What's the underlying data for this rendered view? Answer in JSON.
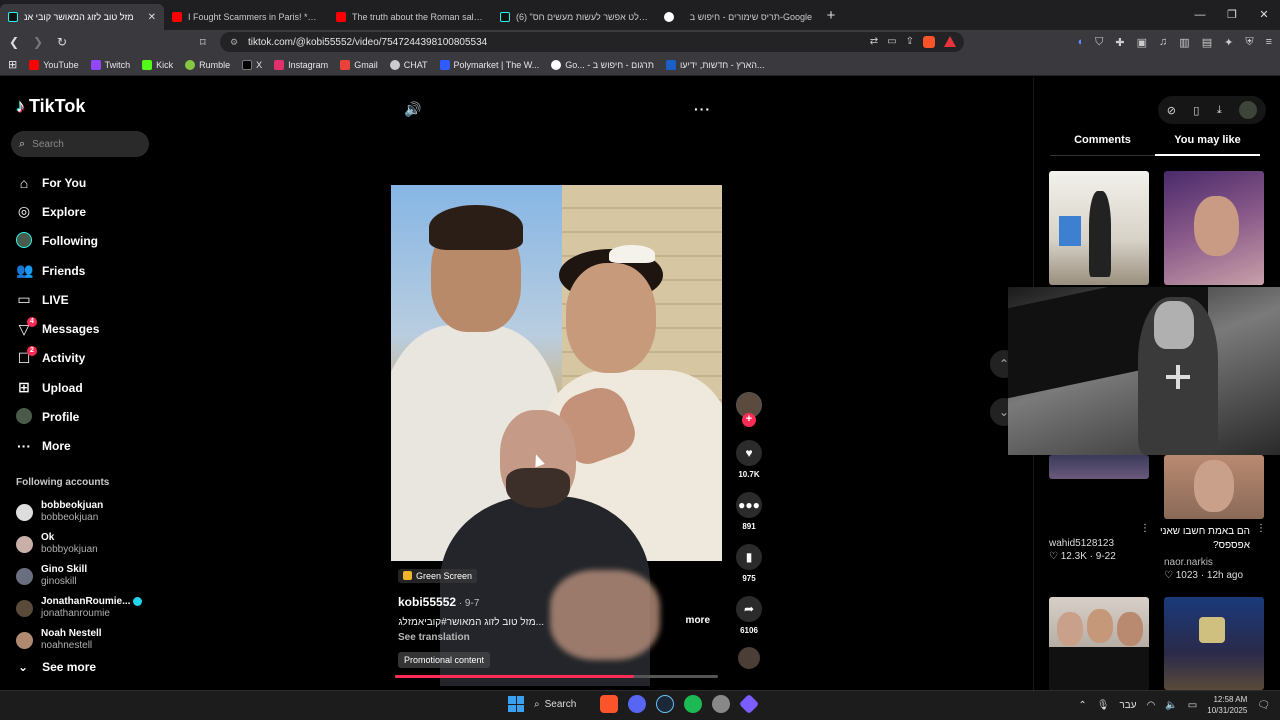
{
  "browser": {
    "tabs": [
      {
        "title": "מזל טוב לזוג המאושר קובי אנ",
        "active": true,
        "color": "#25f4ee"
      },
      {
        "title": "I Fought Scammers in Paris! *attacke",
        "active": false,
        "color": "#ff0000"
      },
      {
        "title": "The truth about the Roman salute #",
        "active": false,
        "color": "#ff0000"
      },
      {
        "title": "(6) \"בהחלט אפשר לעשות מעשים חס",
        "active": false,
        "color": "#25f4ee"
      },
      {
        "title": "תריס שימורים - חיפוש ב-Google",
        "active": false,
        "color": "#4285f4"
      }
    ],
    "new_tab": "+",
    "url": "tiktok.com/@kobi55552/video/7547244398100805534",
    "bookmarks": [
      {
        "label": "YouTube",
        "color": "#ff0000"
      },
      {
        "label": "Twitch",
        "color": "#9146ff"
      },
      {
        "label": "Kick",
        "color": "#53fc18"
      },
      {
        "label": "Rumble",
        "color": "#85c742"
      },
      {
        "label": "X",
        "color": "#000000"
      },
      {
        "label": "Instagram",
        "color": "#e1306c"
      },
      {
        "label": "Gmail",
        "color": "#ea4335"
      },
      {
        "label": "CHAT",
        "color": "#cccccc"
      },
      {
        "label": "Polymarket | The W...",
        "color": "#2e5cff"
      },
      {
        "label": "Go... - תרגום - חיפוש ב",
        "color": "#4285f4"
      },
      {
        "label": "הארץ - חדשות, ידיעו...",
        "color": "#1a5fc8"
      }
    ]
  },
  "tiktok": {
    "brand": "TikTok",
    "search_placeholder": "Search",
    "menu": [
      {
        "label": "For You",
        "icon": "home-icon",
        "badge": ""
      },
      {
        "label": "Explore",
        "icon": "compass-icon",
        "badge": ""
      },
      {
        "label": "Following",
        "icon": "following-icon",
        "badge": ""
      },
      {
        "label": "Friends",
        "icon": "friends-icon",
        "badge": ""
      },
      {
        "label": "LIVE",
        "icon": "live-icon",
        "badge": ""
      },
      {
        "label": "Messages",
        "icon": "messages-icon",
        "badge": "4"
      },
      {
        "label": "Activity",
        "icon": "activity-icon",
        "badge": "2"
      },
      {
        "label": "Upload",
        "icon": "upload-icon",
        "badge": ""
      },
      {
        "label": "Profile",
        "icon": "profile-icon",
        "badge": ""
      },
      {
        "label": "More",
        "icon": "more-icon",
        "badge": ""
      }
    ],
    "following_title": "Following accounts",
    "following": [
      {
        "name": "bobbeokjuan",
        "handle": "bobbeokjuan",
        "verified": false
      },
      {
        "name": "Ok",
        "handle": "bobbyokjuan",
        "verified": false
      },
      {
        "name": "Gino Skill",
        "handle": "ginoskill",
        "verified": false
      },
      {
        "name": "JonathanRoumie...",
        "handle": "jonathanroumie",
        "verified": true
      },
      {
        "name": "Noah Nestell",
        "handle": "noahnestell",
        "verified": false
      }
    ],
    "see_more": "See more"
  },
  "video": {
    "tag": "Green Screen",
    "author": "kobi55552",
    "date": " · 9-7",
    "caption": "...מזל טוב לזוג המאושר#קוביאמזלג",
    "more": "more",
    "see_translation": "See translation",
    "promo": "Promotional content",
    "progress_fraction": 0.74,
    "likes": "10.7K",
    "comments": "891",
    "saves": "975",
    "shares": "6106"
  },
  "right_panel": {
    "tabs": [
      "Comments",
      "You may like"
    ],
    "active_tab": "You may like",
    "item3_author": "wahid5128123",
    "item3_meta": "12.3K · 9-22",
    "item4_caption": "הם באמת חשבו שאני אפספס?",
    "item4_author": "naor.narkis",
    "item4_meta": "1023 · 12h ago"
  },
  "taskbar": {
    "search_label": "Search",
    "lang": "עבר",
    "time": "12:58 AM",
    "date": "10/31/2025"
  }
}
